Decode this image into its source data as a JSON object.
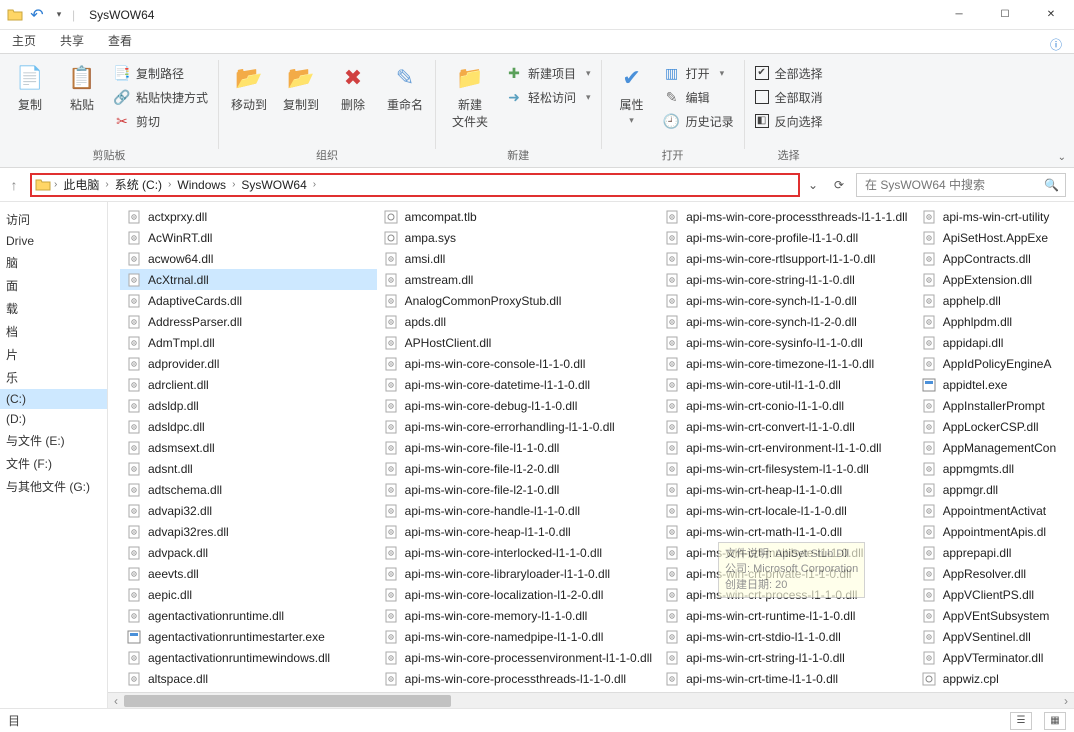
{
  "title": "SysWOW64",
  "tabs": {
    "home": "主页",
    "share": "共享",
    "view": "查看"
  },
  "ribbon": {
    "clipboard": {
      "copy": "复制",
      "paste": "粘贴",
      "copy_path": "复制路径",
      "paste_shortcut": "粘贴快捷方式",
      "cut": "剪切",
      "group": "剪贴板"
    },
    "organize": {
      "move_to": "移动到",
      "copy_to": "复制到",
      "delete": "删除",
      "rename": "重命名",
      "group": "组织"
    },
    "new": {
      "new_folder": "新建\n文件夹",
      "new_item": "新建项目",
      "easy_access": "轻松访问",
      "group": "新建"
    },
    "open": {
      "properties": "属性",
      "open": "打开",
      "edit": "编辑",
      "history": "历史记录",
      "group": "打开"
    },
    "select": {
      "select_all": "全部选择",
      "select_none": "全部取消",
      "invert": "反向选择",
      "group": "选择"
    }
  },
  "breadcrumb": [
    "此电脑",
    "系统 (C:)",
    "Windows",
    "SysWOW64"
  ],
  "search_placeholder": "在 SysWOW64 中搜索",
  "nav": {
    "items": [
      "访问",
      "Drive",
      "脑",
      "面",
      "载",
      "档",
      "片",
      "乐",
      "(C:)",
      "(D:)",
      "与文件 (E:)",
      "文件 (F:)",
      "与其他文件 (G:)"
    ],
    "selected": "(C:)"
  },
  "status": {
    "items_label": "目"
  },
  "tooltip": {
    "l1": "文件说明: ApiSet Stub Dll",
    "l2": "公司: Microsoft Corporation",
    "l3": "创建日期: 20"
  },
  "files": {
    "selected": "AcXtrnal.dll",
    "col1": [
      "actxprxy.dll",
      "AcWinRT.dll",
      "acwow64.dll",
      "AcXtrnal.dll",
      "AdaptiveCards.dll",
      "AddressParser.dll",
      "AdmTmpl.dll",
      "adprovider.dll",
      "adrclient.dll",
      "adsldp.dll",
      "adsldpc.dll",
      "adsmsext.dll",
      "adsnt.dll",
      "adtschema.dll",
      "advapi32.dll",
      "advapi32res.dll",
      "advpack.dll",
      "aeevts.dll",
      "aepic.dll",
      "agentactivationruntime.dll",
      "agentactivationruntimestarter.exe",
      "agentactivationruntimewindows.dll",
      "altspace.dll"
    ],
    "col2": [
      "amcompat.tlb",
      "ampa.sys",
      "amsi.dll",
      "amstream.dll",
      "AnalogCommonProxyStub.dll",
      "apds.dll",
      "APHostClient.dll",
      "api-ms-win-core-console-l1-1-0.dll",
      "api-ms-win-core-datetime-l1-1-0.dll",
      "api-ms-win-core-debug-l1-1-0.dll",
      "api-ms-win-core-errorhandling-l1-1-0.dll",
      "api-ms-win-core-file-l1-1-0.dll",
      "api-ms-win-core-file-l1-2-0.dll",
      "api-ms-win-core-file-l2-1-0.dll",
      "api-ms-win-core-handle-l1-1-0.dll",
      "api-ms-win-core-heap-l1-1-0.dll",
      "api-ms-win-core-interlocked-l1-1-0.dll",
      "api-ms-win-core-libraryloader-l1-1-0.dll",
      "api-ms-win-core-localization-l1-2-0.dll",
      "api-ms-win-core-memory-l1-1-0.dll",
      "api-ms-win-core-namedpipe-l1-1-0.dll",
      "api-ms-win-core-processenvironment-l1-1-0.dll",
      "api-ms-win-core-processthreads-l1-1-0.dll"
    ],
    "col3": [
      "api-ms-win-core-processthreads-l1-1-1.dll",
      "api-ms-win-core-profile-l1-1-0.dll",
      "api-ms-win-core-rtlsupport-l1-1-0.dll",
      "api-ms-win-core-string-l1-1-0.dll",
      "api-ms-win-core-synch-l1-1-0.dll",
      "api-ms-win-core-synch-l1-2-0.dll",
      "api-ms-win-core-sysinfo-l1-1-0.dll",
      "api-ms-win-core-timezone-l1-1-0.dll",
      "api-ms-win-core-util-l1-1-0.dll",
      "api-ms-win-crt-conio-l1-1-0.dll",
      "api-ms-win-crt-convert-l1-1-0.dll",
      "api-ms-win-crt-environment-l1-1-0.dll",
      "api-ms-win-crt-filesystem-l1-1-0.dll",
      "api-ms-win-crt-heap-l1-1-0.dll",
      "api-ms-win-crt-locale-l1-1-0.dll",
      "api-ms-win-crt-math-l1-1-0.dll",
      "api-ms-win-crt-multibyte-l1-1-0.dll",
      "api-ms-win-crt-private-l1-1-0.dll",
      "api-ms-win-crt-process-l1-1-0.dll",
      "api-ms-win-crt-runtime-l1-1-0.dll",
      "api-ms-win-crt-stdio-l1-1-0.dll",
      "api-ms-win-crt-string-l1-1-0.dll",
      "api-ms-win-crt-time-l1-1-0.dll"
    ],
    "col4": [
      "api-ms-win-crt-utility",
      "ApiSetHost.AppExe",
      "AppContracts.dll",
      "AppExtension.dll",
      "apphelp.dll",
      "Apphlpdm.dll",
      "appidapi.dll",
      "AppIdPolicyEngineA",
      "appidtel.exe",
      "AppInstallerPrompt",
      "AppLockerCSP.dll",
      "AppManagementCon",
      "appmgmts.dll",
      "appmgr.dll",
      "AppointmentActivat",
      "AppointmentApis.dl",
      "apprepapi.dll",
      "AppResolver.dll",
      "AppVClientPS.dll",
      "AppVEntSubsystem",
      "AppVSentinel.dll",
      "AppVTerminator.dll",
      "appwiz.cpl"
    ]
  }
}
